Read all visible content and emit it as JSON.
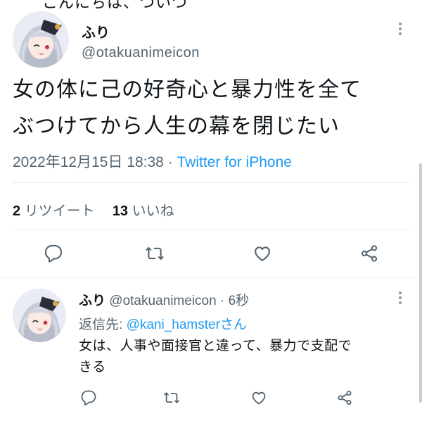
{
  "top_cut_text": "こんにちは、ついつ",
  "main_tweet": {
    "display_name": "ふり",
    "handle": "@otakuanimeicon",
    "text_line1": "女の体に己の好奇心と暴力性を全て",
    "text_line2": "ぶつけてから人生の幕を閉じたい",
    "timestamp": "2022年12月15日 18:38",
    "separator": "·",
    "source": "Twitter for iPhone",
    "retweet_count": "2",
    "retweet_label": "リツイート",
    "like_count": "13",
    "like_label": "いいね"
  },
  "reply_tweet": {
    "display_name": "ふり",
    "handle": "@otakuanimeicon",
    "separator": "·",
    "time": "6秒",
    "reply_prefix": "返信先:",
    "reply_mention": "@kani_hamster",
    "reply_suffix": "さん",
    "text_line1": "女は、人事や面接官と違って、暴力で支配で",
    "text_line2": "きる"
  },
  "icons": {
    "reply": "reply-icon",
    "retweet": "retweet-icon",
    "like": "heart-icon",
    "share": "share-icon",
    "more": "more-icon"
  },
  "colors": {
    "text": "#0f1419",
    "secondary": "#536471",
    "accent": "#1d9bf0",
    "divider": "#e8ecef"
  }
}
